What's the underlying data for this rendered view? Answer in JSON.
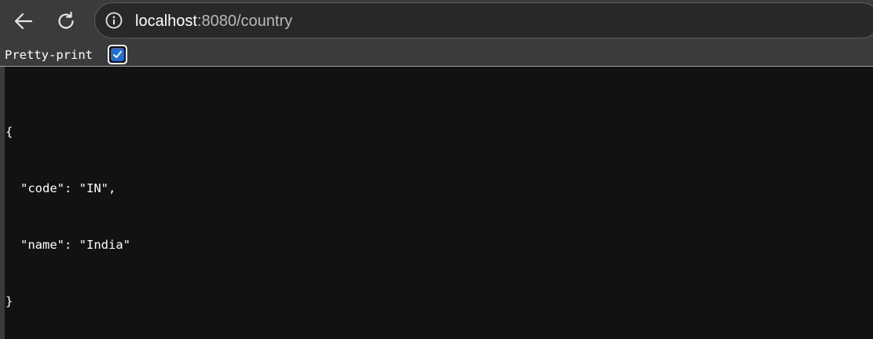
{
  "browser": {
    "icons": {
      "back": "arrow-left-icon",
      "reload": "reload-icon",
      "site_info": "info-circle-icon"
    },
    "address": {
      "host": "localhost",
      "path": ":8080/country"
    }
  },
  "viewer": {
    "pretty_print_label": "Pretty-print",
    "pretty_print_checked": true,
    "checkbox_color": "#1a6fd8"
  },
  "json_lines": {
    "open_brace": "{",
    "line_code": "\"code\": \"IN\",",
    "line_name": "\"name\": \"India\"",
    "close_brace": "}"
  }
}
